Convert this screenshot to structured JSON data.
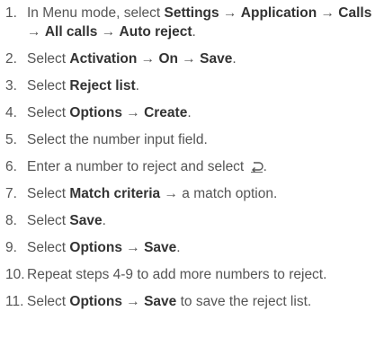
{
  "steps": [
    {
      "number": "1.",
      "parts": [
        {
          "t": "In Menu mode, select ",
          "b": false
        },
        {
          "t": "Settings",
          "b": true
        },
        {
          "t": " → ",
          "b": false
        },
        {
          "t": "Application",
          "b": true
        },
        {
          "t": " → ",
          "b": false
        },
        {
          "t": "Calls",
          "b": true
        },
        {
          "t": " → ",
          "b": false
        },
        {
          "t": "All calls",
          "b": true
        },
        {
          "t": " → ",
          "b": false
        },
        {
          "t": "Auto reject",
          "b": true
        },
        {
          "t": ".",
          "b": false
        }
      ]
    },
    {
      "number": "2.",
      "parts": [
        {
          "t": "Select ",
          "b": false
        },
        {
          "t": "Activation",
          "b": true
        },
        {
          "t": " → ",
          "b": false
        },
        {
          "t": "On",
          "b": true
        },
        {
          "t": " → ",
          "b": false
        },
        {
          "t": "Save",
          "b": true
        },
        {
          "t": ".",
          "b": false
        }
      ]
    },
    {
      "number": "3.",
      "parts": [
        {
          "t": "Select ",
          "b": false
        },
        {
          "t": "Reject list",
          "b": true
        },
        {
          "t": ".",
          "b": false
        }
      ]
    },
    {
      "number": "4.",
      "parts": [
        {
          "t": "Select ",
          "b": false
        },
        {
          "t": "Options",
          "b": true
        },
        {
          "t": " → ",
          "b": false
        },
        {
          "t": "Create",
          "b": true
        },
        {
          "t": ".",
          "b": false
        }
      ]
    },
    {
      "number": "5.",
      "parts": [
        {
          "t": "Select the number input field.",
          "b": false
        }
      ]
    },
    {
      "number": "6.",
      "parts": [
        {
          "t": "Enter a number to reject and select ",
          "b": false
        },
        {
          "icon": "back-key-icon"
        },
        {
          "t": ".",
          "b": false
        }
      ]
    },
    {
      "number": "7.",
      "parts": [
        {
          "t": "Select ",
          "b": false
        },
        {
          "t": "Match criteria",
          "b": true
        },
        {
          "t": " → a match option.",
          "b": false
        }
      ]
    },
    {
      "number": "8.",
      "parts": [
        {
          "t": "Select ",
          "b": false
        },
        {
          "t": "Save",
          "b": true
        },
        {
          "t": ".",
          "b": false
        }
      ]
    },
    {
      "number": "9.",
      "parts": [
        {
          "t": "Select ",
          "b": false
        },
        {
          "t": "Options",
          "b": true
        },
        {
          "t": " → ",
          "b": false
        },
        {
          "t": "Save",
          "b": true
        },
        {
          "t": ".",
          "b": false
        }
      ]
    },
    {
      "number": "10.",
      "parts": [
        {
          "t": "Repeat steps 4-9 to add more numbers to reject.",
          "b": false
        }
      ]
    },
    {
      "number": "11.",
      "parts": [
        {
          "t": "Select ",
          "b": false
        },
        {
          "t": "Options",
          "b": true
        },
        {
          "t": " → ",
          "b": false
        },
        {
          "t": "Save",
          "b": true
        },
        {
          "t": " to save the reject list.",
          "b": false
        }
      ]
    }
  ]
}
